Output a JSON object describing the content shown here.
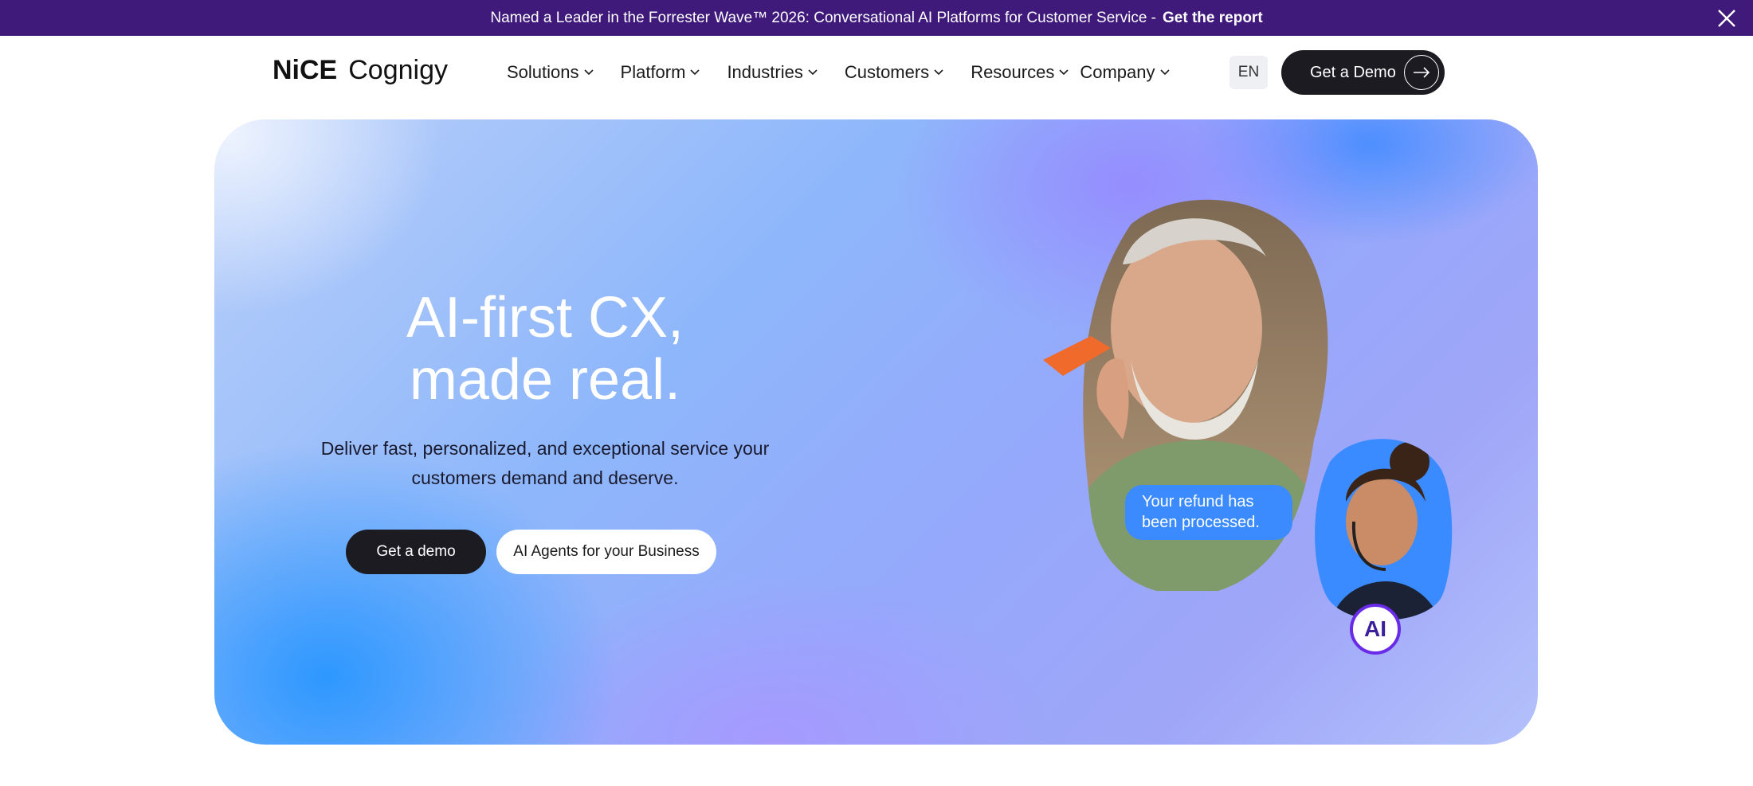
{
  "announcement": {
    "text": "Named a Leader in the Forrester Wave™ 2026: Conversational AI Platforms for Customer Service -",
    "link": "Get the report",
    "close_icon": "close-icon"
  },
  "header": {
    "logo_nice": "NiCE",
    "logo_cognigy": "Cognigy",
    "nav": [
      {
        "label": "Solutions"
      },
      {
        "label": "Platform"
      },
      {
        "label": "Industries"
      },
      {
        "label": "Customers"
      },
      {
        "label": "Resources"
      },
      {
        "label": "Company"
      }
    ],
    "language": "EN",
    "cta": "Get a Demo"
  },
  "hero": {
    "title_line1": "AI-first CX,",
    "title_line2": "made real.",
    "subtitle_line1": "Deliver fast, personalized, and exceptional service your",
    "subtitle_line2": "customers demand and deserve.",
    "primary_button": "Get a demo",
    "secondary_button": "AI Agents for your Business",
    "bubble_line1": "Your refund has",
    "bubble_line2": "been processed.",
    "ai_badge": "AI"
  },
  "colors": {
    "announcement_bg": "#3f1a7a",
    "dark_button": "#1c1b22",
    "bubble": "#3b8bff",
    "badge_ring": "#6a2be8"
  }
}
